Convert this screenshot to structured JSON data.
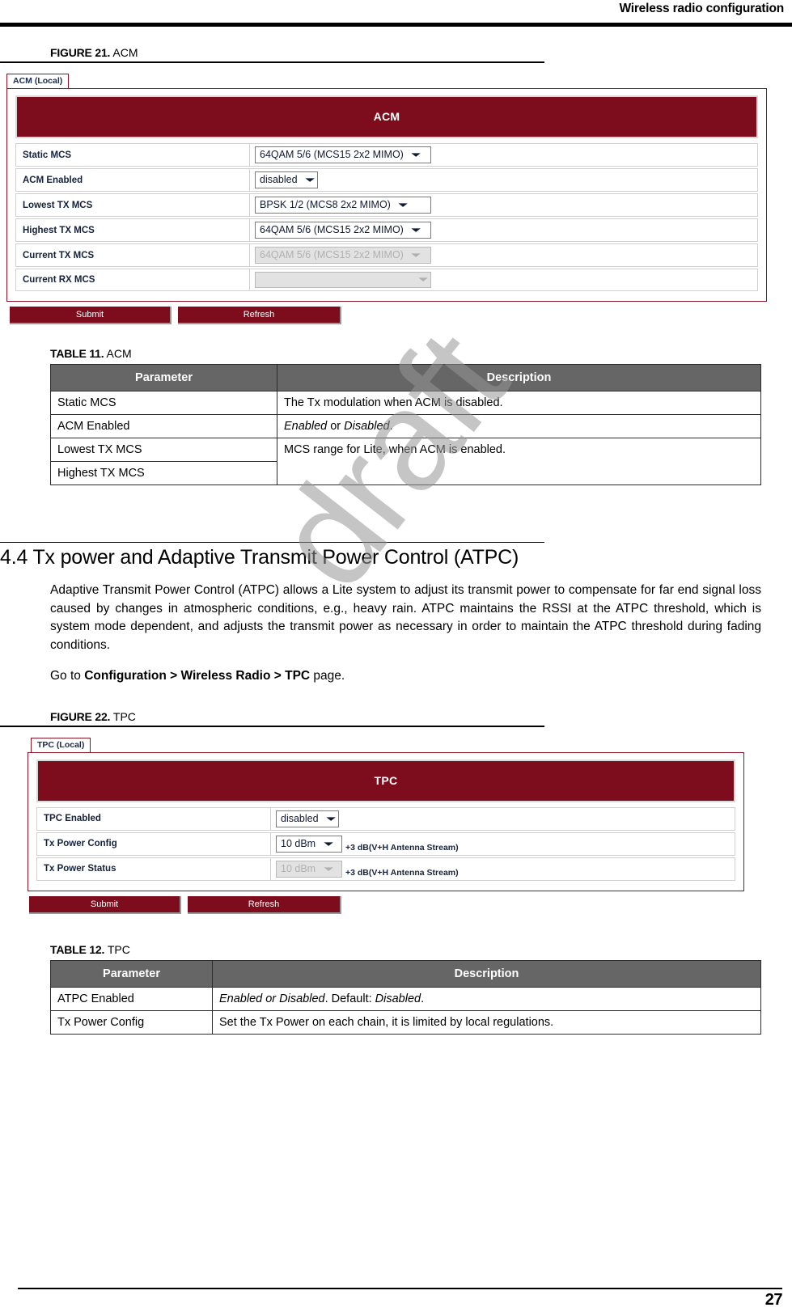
{
  "header": {
    "title": "Wireless radio configuration"
  },
  "footer": {
    "page_number": "27"
  },
  "watermark": {
    "text": "draft"
  },
  "colors": {
    "panel_red": "#7d0c1c",
    "tab_border_red": "#8b1424",
    "table_header_gray": "#666666",
    "label_blue": "#14213d"
  },
  "figure21": {
    "label": "FIGURE 21.",
    "title": "ACM",
    "tab_label": "ACM (Local)",
    "panel_title": "ACM",
    "rows": [
      {
        "label": "Static MCS",
        "value": "64QAM 5/6 (MCS15 2x2 MIMO)",
        "disabled": false
      },
      {
        "label": "ACM Enabled",
        "value": "disabled",
        "disabled": false
      },
      {
        "label": "Lowest TX MCS",
        "value": "BPSK 1/2 (MCS8 2x2 MIMO)",
        "disabled": false
      },
      {
        "label": "Highest TX MCS",
        "value": "64QAM 5/6 (MCS15 2x2 MIMO)",
        "disabled": false
      },
      {
        "label": "Current TX MCS",
        "value": "64QAM 5/6 (MCS15 2x2 MIMO)",
        "disabled": true
      },
      {
        "label": "Current RX MCS",
        "value": "",
        "disabled": true
      }
    ],
    "submit_label": "Submit",
    "refresh_label": "Refresh"
  },
  "table11": {
    "label": "TABLE 11.",
    "title": "ACM",
    "columns": [
      "Parameter",
      "Description"
    ],
    "rows": [
      {
        "parameter": "Static MCS",
        "description": "The Tx modulation when ACM is disabled."
      },
      {
        "parameter": "ACM Enabled",
        "description": "Enabled or Disabled."
      },
      {
        "parameter": "Lowest TX MCS",
        "description": "MCS range for Lite, when ACM is enabled."
      },
      {
        "parameter": "Highest TX MCS",
        "description": ""
      }
    ]
  },
  "section44": {
    "heading": "4.4 Tx power and Adaptive Transmit Power Control (ATPC)",
    "paragraph": "Adaptive Transmit Power Control (ATPC) allows a Lite system to adjust its transmit power to compensate for far end signal loss caused by changes in atmospheric conditions, e.g., heavy rain. ATPC maintains the RSSI at the ATPC threshold, which is system mode dependent, and adjusts the transmit power as necessary in order to maintain the ATPC threshold during fading conditions.",
    "goto_prefix": "Go to ",
    "goto_path": "Configuration > Wireless Radio > TPC",
    "goto_suffix": " page."
  },
  "figure22": {
    "label": "FIGURE 22.",
    "title": "TPC",
    "tab_label": "TPC (Local)",
    "panel_title": "TPC",
    "rows": [
      {
        "label": "TPC Enabled",
        "value": "disabled",
        "note": "",
        "disabled": false
      },
      {
        "label": "Tx Power Config",
        "value": "10 dBm",
        "note": "+3 dB(V+H Antenna Stream)",
        "disabled": false
      },
      {
        "label": "Tx Power Status",
        "value": "10 dBm",
        "note": "+3 dB(V+H Antenna Stream)",
        "disabled": true
      }
    ],
    "submit_label": "Submit",
    "refresh_label": "Refresh"
  },
  "table12": {
    "label": "TABLE 12.",
    "title": "TPC",
    "columns": [
      "Parameter",
      "Description"
    ],
    "rows": [
      {
        "parameter": "ATPC Enabled",
        "description": "Enabled or Disabled. Default: Disabled."
      },
      {
        "parameter": "Tx Power Config",
        "description": "Set the Tx Power on each chain, it is limited by local regulations."
      }
    ]
  }
}
